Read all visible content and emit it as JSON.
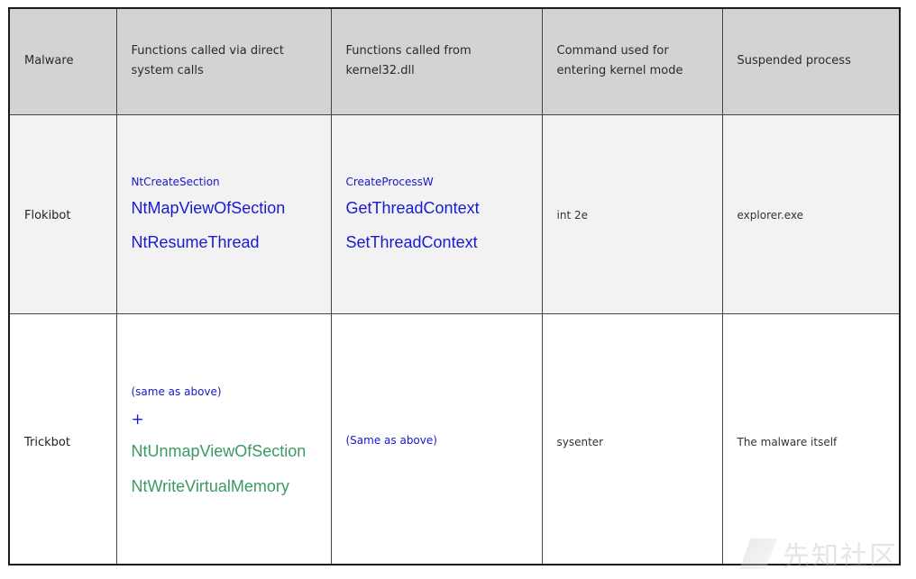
{
  "table": {
    "headers": [
      "Malware",
      "Functions called via direct system calls",
      "Functions called from kernel32.dll",
      "Command used for entering kernel mode",
      "Suspended process"
    ],
    "rows": [
      {
        "malware": "Flokibot",
        "direct_calls": {
          "small": "NtCreateSection",
          "large": [
            "NtMapViewOfSection",
            "NtResumeThread"
          ]
        },
        "kernel32": {
          "small": "CreateProcessW",
          "large": [
            "GetThreadContext",
            "SetThreadContext"
          ]
        },
        "kernel_mode_command": "int 2e",
        "suspended_process": "explorer.exe"
      },
      {
        "malware": "Trickbot",
        "direct_calls": {
          "small": "(same as above)",
          "plus": "+",
          "large": [
            "NtUnmapViewOfSection",
            "NtWriteVirtualMemory"
          ]
        },
        "kernel32": {
          "small": "(Same as above)"
        },
        "kernel_mode_command": "sysenter",
        "suspended_process": "The malware itself"
      }
    ]
  },
  "colors": {
    "header_bg": "#d3d3d3",
    "row1_bg": "#f2f2f2",
    "link_blue": "#1a1ad0",
    "link_green": "#3a9a64"
  },
  "watermark": {
    "text": "先知社区",
    "logo": "xianzhi-logo"
  }
}
